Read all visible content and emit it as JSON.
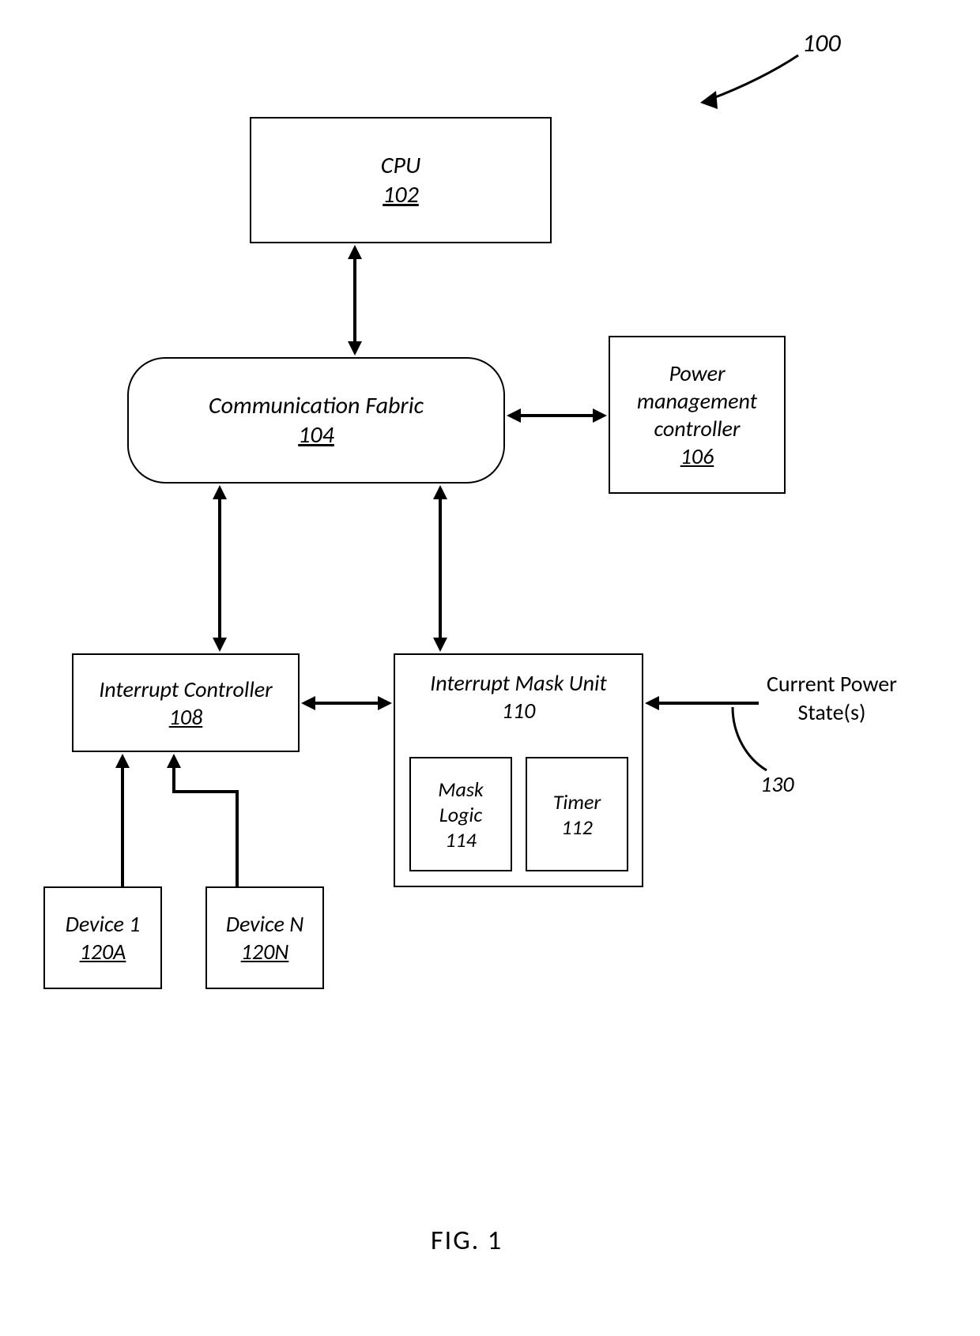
{
  "figure": {
    "ref_number": "100",
    "caption": "FIG. 1"
  },
  "blocks": {
    "cpu": {
      "label": "CPU",
      "ref": "102"
    },
    "fabric": {
      "label": "Communication Fabric",
      "ref": "104"
    },
    "pmc": {
      "label1": "Power",
      "label2": "management",
      "label3": "controller",
      "ref": "106"
    },
    "ic": {
      "label": "Interrupt Controller",
      "ref": "108"
    },
    "imu": {
      "label": "Interrupt Mask Unit",
      "ref": "110"
    },
    "mask": {
      "label1": "Mask",
      "label2": "Logic",
      "ref": "114"
    },
    "timer": {
      "label": "Timer",
      "ref": "112"
    },
    "dev1": {
      "label": "Device 1",
      "ref": "120A"
    },
    "devn": {
      "label": "Device N",
      "ref": "120N"
    }
  },
  "labels": {
    "cps_line1": "Current Power",
    "cps_line2": "State(s)",
    "cps_ref": "130"
  }
}
